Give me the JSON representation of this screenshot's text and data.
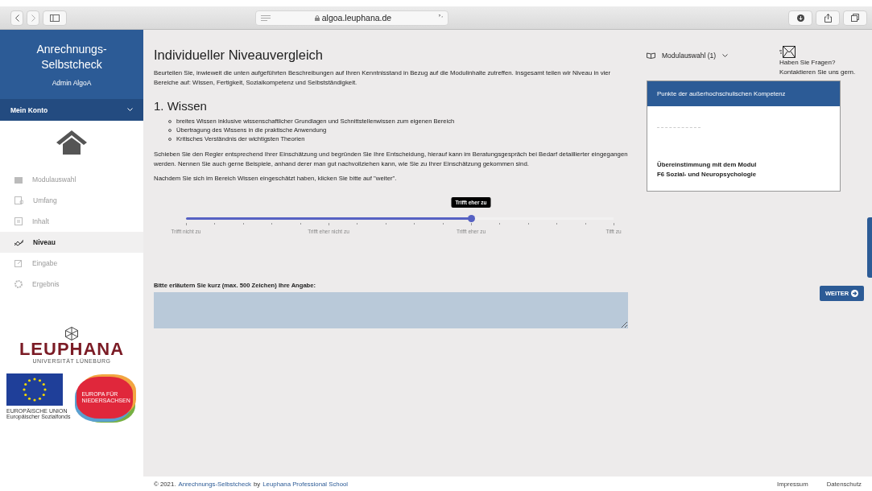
{
  "browser": {
    "url": "algoa.leuphana.de"
  },
  "sidebar": {
    "title": "Anrechnungs-\nSelbstcheck",
    "user": "Admin AlgoA",
    "account": {
      "label": "Mein Konto",
      "expanded": false
    },
    "items": [
      {
        "label": "Modulauswahl",
        "kind": "folder",
        "selected": false
      },
      {
        "label": "Umfang",
        "kind": "scope",
        "selected": false
      },
      {
        "label": "Inhalt",
        "kind": "content",
        "selected": false
      },
      {
        "label": "Niveau",
        "kind": "level",
        "selected": true
      },
      {
        "label": "Eingabe",
        "kind": "edit",
        "selected": false
      },
      {
        "label": "Ergebnis",
        "kind": "result",
        "selected": false
      }
    ],
    "logo": {
      "name": "LEUPHANA",
      "subtitle": "UNIVERSITÄT LÜNEBURG"
    },
    "eu": {
      "name": "EUROPÄISCHE UNION",
      "fund": "Europäischer Sozialfonds"
    },
    "nds": {
      "line1": "EUROPA FÜR",
      "line2": "NIEDERSACHSEN"
    }
  },
  "main": {
    "title": "Individueller Niveauvergleich",
    "intro": "Beurteilen Sie, inwieweit die unten aufgeführten Beschreibungen auf Ihren Kenntnisstand in Bezug auf die Modulinhalte zutreffen. Insgesamt teilen wir Niveau in vier Bereiche auf: Wissen, Fertigkeit, Sozialkompetenz und Selbstständigkeit.",
    "section": "1. Wissen",
    "bullets": [
      "breites Wissen inklusive wissenschaftlicher Grundlagen und Schnittstellenwissen zum eigenen Bereich",
      "Übertragung des Wissens in die praktische Anwendung",
      "Kritisches Verständnis der wichtigsten Theorien"
    ],
    "instructions": [
      "Schieben Sie den Regler entsprechend Ihrer Einschätzung und begründen Sie Ihre Entscheidung, hierauf kann im Beratungsgespräch bei Bedarf detaillierter eingegangen werden. Nennen Sie auch gerne Beispiele, anhand derer man gut nachvollziehen kann, wie Sie zu Ihrer Einschätzung gekommen sind.",
      "Nachdem Sie sich im Bereich Wissen eingeschätzt haben, klicken Sie bitte auf \"weiter\"."
    ],
    "slider": {
      "level": 0.6667,
      "tooltip": "Trifft eher zu",
      "labels": [
        "Trifft nicht zu",
        "Trifft eher nicht zu",
        "Trifft eher zu",
        "Tifft zu"
      ]
    },
    "answer_label": "Bitte erläutern Sie kurz (max. 500 Zeichen) Ihre Angabe:",
    "next_button": "WEITER"
  },
  "right": {
    "module_select": "Modulauswahl (1)",
    "contact": [
      "Haben Sie Fragen?",
      "Kontaktieren Sie uns gern."
    ],
    "card": {
      "title": "Punkte der außerhochschulischen Kompetenz",
      "match": "Übereinstimmung mit dem Modul\nF6 Sozial- und Neuropsychologie"
    }
  },
  "footer": {
    "copyright": "© 2021.",
    "site_link": "Anrechnungs-Selbstcheck",
    "by": "by",
    "org_link": "Leuphana Professional School",
    "links": [
      "Impressum",
      "Datenschutz"
    ]
  }
}
